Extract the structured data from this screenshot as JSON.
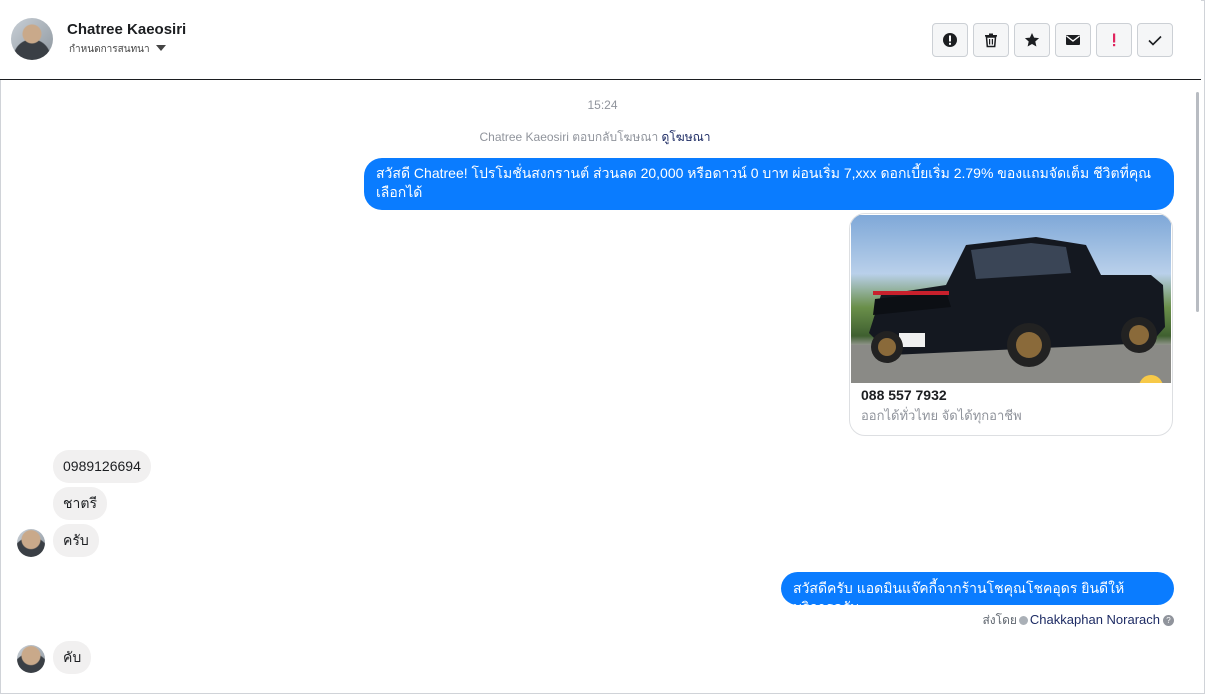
{
  "header": {
    "contact_name": "Chatree Kaeosiri",
    "sub_label": "กำหนดการสนทนา",
    "actions": [
      {
        "name": "report-icon"
      },
      {
        "name": "trash-icon"
      },
      {
        "name": "star-icon"
      },
      {
        "name": "mail-icon"
      },
      {
        "name": "exclamation-icon"
      },
      {
        "name": "check-icon"
      }
    ]
  },
  "thread": {
    "time": "15:24",
    "reply_note": "Chatree Kaeosiri ตอบกลับโฆษณา",
    "reply_link": "ดูโฆษณา",
    "promo_message": "สวัสดี Chatree! โปรโมชั่นสงกรานต์ ส่วนลด 20,000 หรือดาวน์ 0 บาท ผ่อนเริ่ม 7,xxx ดอกเบี้ยเริ่ม 2.79% ของแถมจัดเต็ม ชีวิตที่คุณเลือกได้",
    "card": {
      "title": "088 557 7932",
      "subtitle": "ออกได้ทั่วไทย จัดได้ทุกอาชีพ"
    },
    "incoming_1": [
      "0989126694",
      "ชาตรี",
      "ครับ"
    ],
    "outgoing_reply": "สวัสดีครับ แอดมินแจ๊คกี้จากร้านโชคุณโชคอุดร ยินดีให้บริการครับ",
    "sent_by_label": "ส่งโดย",
    "sent_by_name": "Chakkaphan Norarach",
    "incoming_2": "คับ"
  },
  "colors": {
    "outgoing_bubble": "#0a7cff",
    "incoming_bubble": "#f1f0f0",
    "link": "#1d2b64"
  }
}
